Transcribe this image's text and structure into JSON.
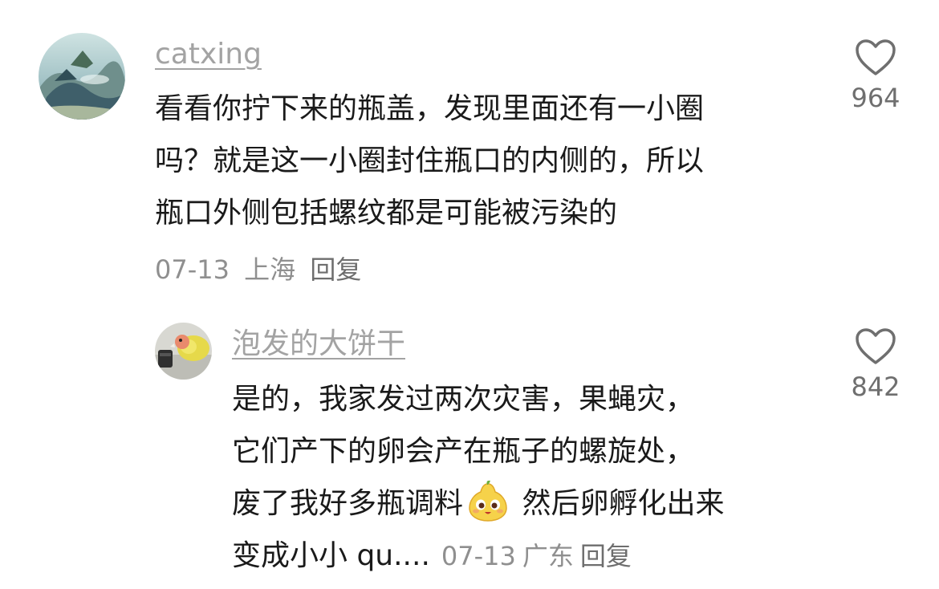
{
  "comments": [
    {
      "username": "catxing",
      "lines": [
        "看看你拧下来的瓶盖，发现里面还有一小圈",
        "吗？就是这一小圈封住瓶口的内侧的，所以",
        "瓶口外侧包括螺纹都是可能被污染的"
      ],
      "date": "07-13",
      "location": "上海",
      "reply_label": "回复",
      "likes": "964",
      "avatar_icon": "landscape-avatar"
    },
    {
      "username": "泡发的大饼干",
      "lines": [
        "是的，我家发过两次灾害，果蝇灾，",
        "它们产下的卵会产在瓶子的螺旋处，",
        "废了我好多瓶调料",
        "然后卵孵化出来",
        "变成小小 qu...."
      ],
      "date": "07-13",
      "location": "广东",
      "reply_label": "回复",
      "likes": "842",
      "avatar_icon": "parrot-avatar",
      "emoji_icon": "pear-face-emoji"
    }
  ],
  "colors": {
    "text": "#1a1a1a",
    "username": "#a3a3a3",
    "meta": "#8f8f8f",
    "like_icon": "#6f6f6f"
  }
}
